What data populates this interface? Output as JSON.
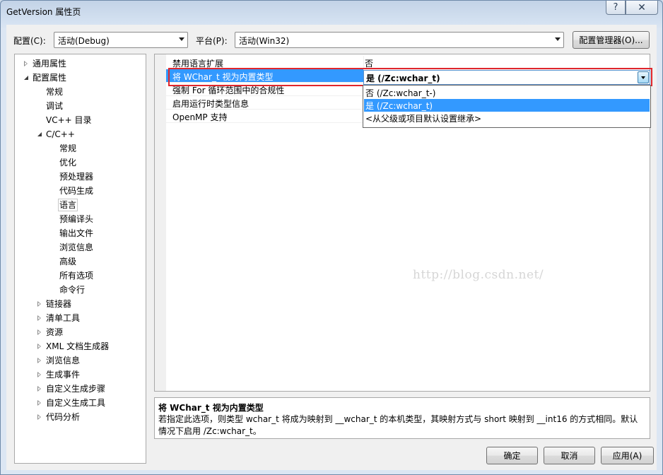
{
  "window": {
    "title": "GetVersion 属性页",
    "help_glyph": "?",
    "close_glyph": "✕"
  },
  "toolbar": {
    "config_label": "配置(C):",
    "config_value": "活动(Debug)",
    "platform_label": "平台(P):",
    "platform_value": "活动(Win32)",
    "config_manager_label": "配置管理器(O)..."
  },
  "tree": {
    "items": [
      {
        "label": "通用属性",
        "level": 0,
        "expander": "collapsed"
      },
      {
        "label": "配置属性",
        "level": 0,
        "expander": "expanded"
      },
      {
        "label": "常规",
        "level": 1,
        "expander": "none"
      },
      {
        "label": "调试",
        "level": 1,
        "expander": "none"
      },
      {
        "label": "VC++ 目录",
        "level": 1,
        "expander": "none"
      },
      {
        "label": "C/C++",
        "level": 1,
        "expander": "expanded"
      },
      {
        "label": "常规",
        "level": 2,
        "expander": "none"
      },
      {
        "label": "优化",
        "level": 2,
        "expander": "none"
      },
      {
        "label": "预处理器",
        "level": 2,
        "expander": "none"
      },
      {
        "label": "代码生成",
        "level": 2,
        "expander": "none"
      },
      {
        "label": "语言",
        "level": 2,
        "expander": "none",
        "selected": true
      },
      {
        "label": "预编译头",
        "level": 2,
        "expander": "none"
      },
      {
        "label": "输出文件",
        "level": 2,
        "expander": "none"
      },
      {
        "label": "浏览信息",
        "level": 2,
        "expander": "none"
      },
      {
        "label": "高级",
        "level": 2,
        "expander": "none"
      },
      {
        "label": "所有选项",
        "level": 2,
        "expander": "none"
      },
      {
        "label": "命令行",
        "level": 2,
        "expander": "none"
      },
      {
        "label": "链接器",
        "level": 1,
        "expander": "collapsed"
      },
      {
        "label": "清单工具",
        "level": 1,
        "expander": "collapsed"
      },
      {
        "label": "资源",
        "level": 1,
        "expander": "collapsed"
      },
      {
        "label": "XML 文档生成器",
        "level": 1,
        "expander": "collapsed"
      },
      {
        "label": "浏览信息",
        "level": 1,
        "expander": "collapsed"
      },
      {
        "label": "生成事件",
        "level": 1,
        "expander": "collapsed"
      },
      {
        "label": "自定义生成步骤",
        "level": 1,
        "expander": "collapsed"
      },
      {
        "label": "自定义生成工具",
        "level": 1,
        "expander": "collapsed"
      },
      {
        "label": "代码分析",
        "level": 1,
        "expander": "collapsed"
      }
    ]
  },
  "grid": {
    "rows": [
      {
        "name": "禁用语言扩展",
        "value": "否"
      },
      {
        "name": "将 WChar_t 视为内置类型",
        "value": "是 (/Zc:wchar_t)",
        "selected": true
      },
      {
        "name": "强制 For 循环范围中的合规性",
        "value": ""
      },
      {
        "name": "启用运行时类型信息",
        "value": ""
      },
      {
        "name": "OpenMP 支持",
        "value": ""
      }
    ],
    "dropdown_options": [
      {
        "label": "否 (/Zc:wchar_t-)",
        "highlighted": false
      },
      {
        "label": "是 (/Zc:wchar_t)",
        "highlighted": true
      },
      {
        "label": "<从父级或项目默认设置继承>",
        "highlighted": false
      }
    ]
  },
  "watermark": "http://blog.csdn.net/",
  "description": {
    "title": "将 WChar_t 视为内置类型",
    "text": "若指定此选项，则类型 wchar_t 将成为映射到 __wchar_t 的本机类型，其映射方式与 short 映射到 __int16 的方式相同。默认情况下启用 /Zc:wchar_t。"
  },
  "footer": {
    "ok_label": "确定",
    "cancel_label": "取消",
    "apply_label": "应用(A)"
  },
  "colors": {
    "selection": "#3399ff",
    "highlight_frame": "#e0262c"
  }
}
